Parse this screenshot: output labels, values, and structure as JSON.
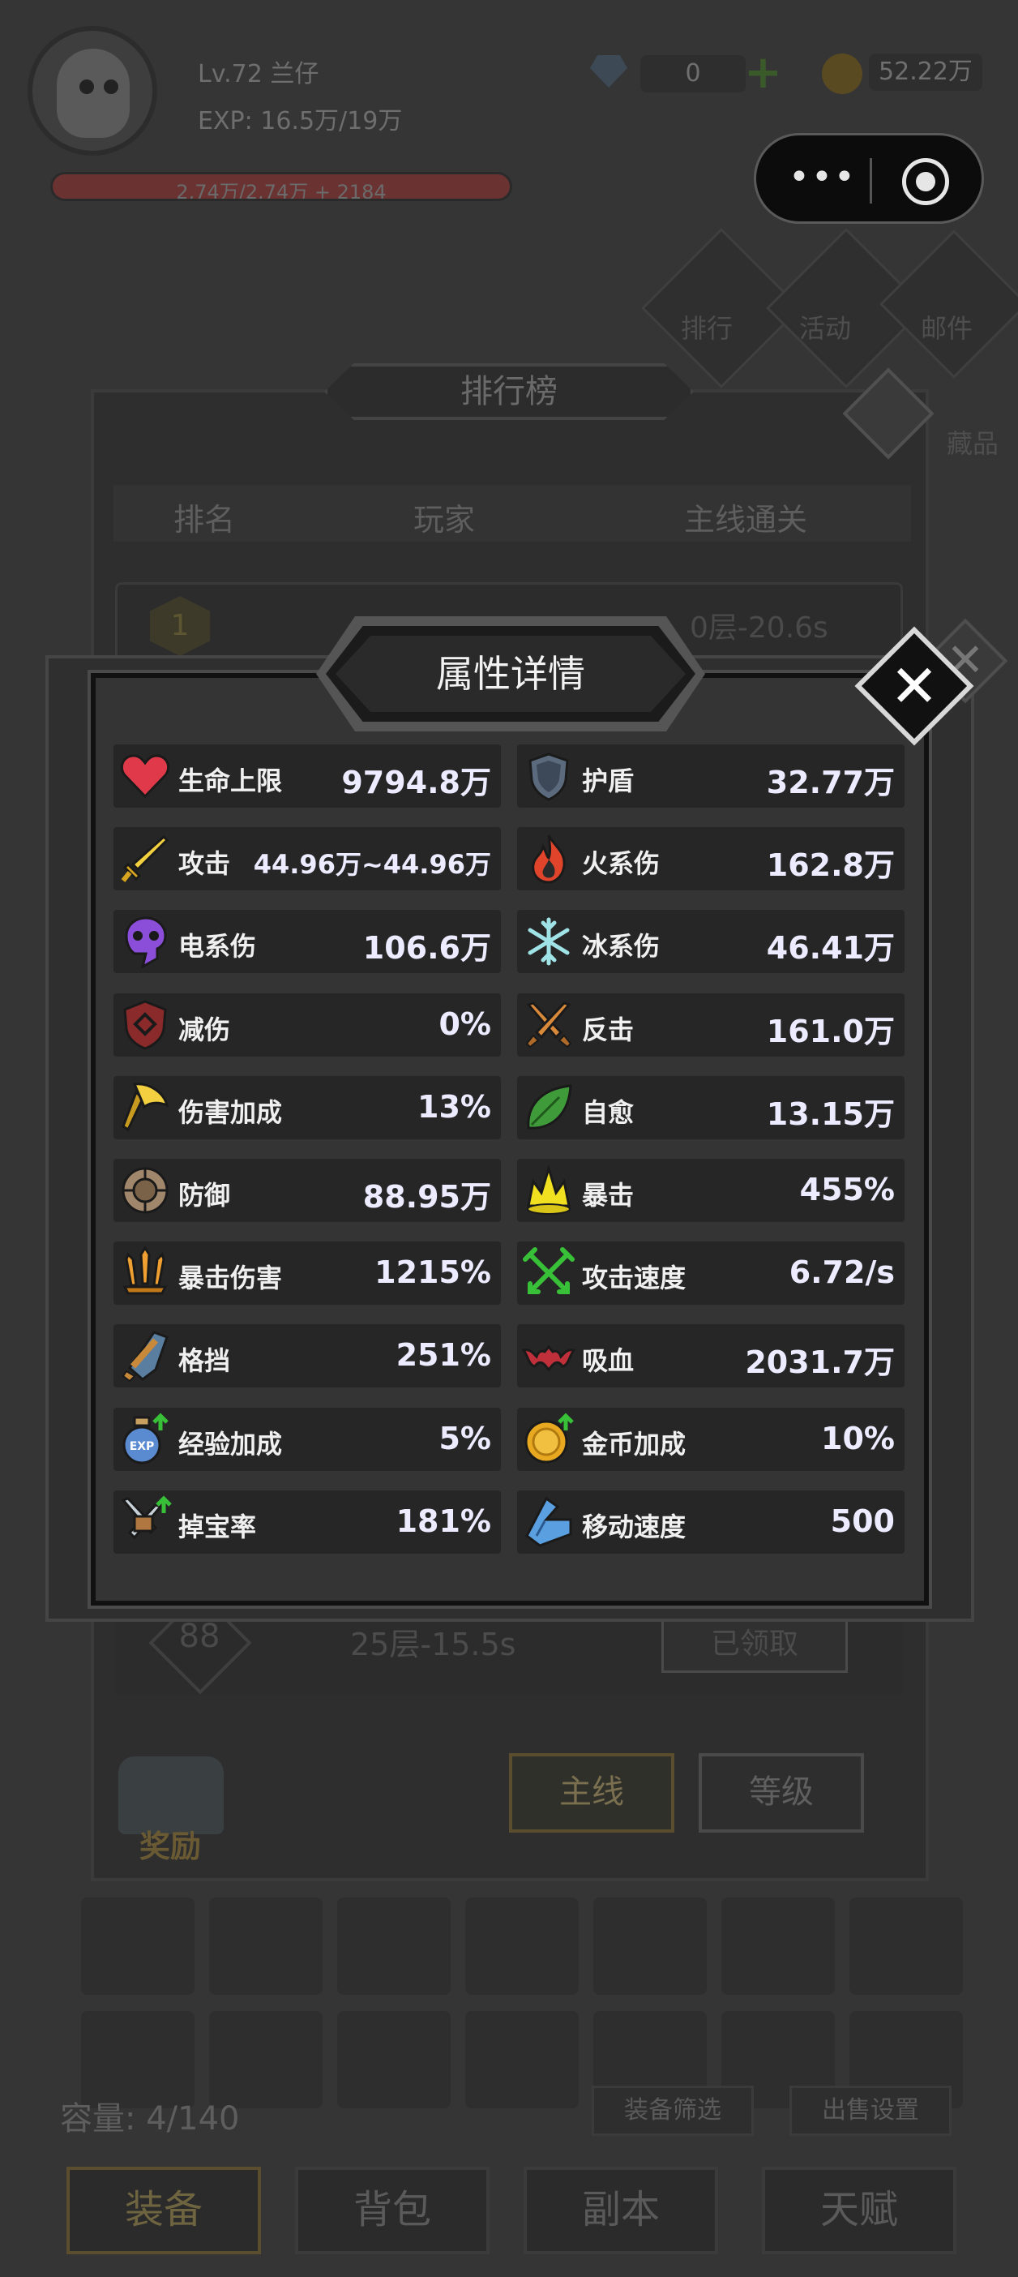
{
  "player": {
    "level_name": "Lv.72 兰仔",
    "exp": "EXP: 16.5万/19万",
    "hp": "2.74万/2.74万 + 2184"
  },
  "currency": {
    "gems": "0",
    "gold": "52.22万"
  },
  "top_icons": {
    "rank": "排行",
    "activity": "活动",
    "mail": "邮件",
    "collection": "藏品"
  },
  "leaderboard": {
    "title": "排行榜",
    "col_rank": "排名",
    "col_player": "玩家",
    "col_stage": "主线通关",
    "row1_rank": "1",
    "row1_stage": "0层-20.6s",
    "bottom_rank": "88",
    "bottom_stage": "25层-15.5s",
    "bottom_btn": "已领取",
    "tab_main": "主线",
    "tab_level": "等级",
    "reward": "奖励"
  },
  "inventory": {
    "capacity": "容量: 4/140",
    "filter_btn": "装备筛选",
    "sell_btn": "出售设置"
  },
  "nav": {
    "equip": "装备",
    "bag": "背包",
    "dungeon": "副本",
    "talent": "天赋"
  },
  "modal": {
    "title": "属性详情",
    "stats": [
      {
        "name": "生命上限",
        "value": "9794.8万",
        "icon": "heart-icon"
      },
      {
        "name": "护盾",
        "value": "32.77万",
        "icon": "shield-icon"
      },
      {
        "name": "攻击",
        "value": "44.96万~44.96万",
        "icon": "sword-icon"
      },
      {
        "name": "火系伤",
        "value": "162.8万",
        "icon": "fire-icon"
      },
      {
        "name": "电系伤",
        "value": "106.6万",
        "icon": "lightning-skull-icon"
      },
      {
        "name": "冰系伤",
        "value": "46.41万",
        "icon": "snowflake-icon"
      },
      {
        "name": "减伤",
        "value": "0%",
        "icon": "crest-shield-icon"
      },
      {
        "name": "反击",
        "value": "161.0万",
        "icon": "crossed-swords-icon"
      },
      {
        "name": "伤害加成",
        "value": "13%",
        "icon": "axe-icon"
      },
      {
        "name": "自愈",
        "value": "13.15万",
        "icon": "leaf-icon"
      },
      {
        "name": "防御",
        "value": "88.95万",
        "icon": "round-shield-icon"
      },
      {
        "name": "暴击",
        "value": "455%",
        "icon": "burst-icon"
      },
      {
        "name": "暴击伤害",
        "value": "1215%",
        "icon": "triple-swords-icon"
      },
      {
        "name": "攻击速度",
        "value": "6.72/s",
        "icon": "crossed-arrows-icon"
      },
      {
        "name": "格挡",
        "value": "251%",
        "icon": "kite-shield-icon"
      },
      {
        "name": "吸血",
        "value": "2031.7万",
        "icon": "bat-icon"
      },
      {
        "name": "经验加成",
        "value": "5%",
        "icon": "exp-potion-icon"
      },
      {
        "name": "金币加成",
        "value": "10%",
        "icon": "gold-coin-up-icon"
      },
      {
        "name": "掉宝率",
        "value": "181%",
        "icon": "loot-swords-icon"
      },
      {
        "name": "移动速度",
        "value": "500",
        "icon": "boot-icon"
      }
    ]
  },
  "colors": {
    "value_text": "#ecebff",
    "modal_bg": "#343434",
    "stat_row_bg": "#262626"
  }
}
